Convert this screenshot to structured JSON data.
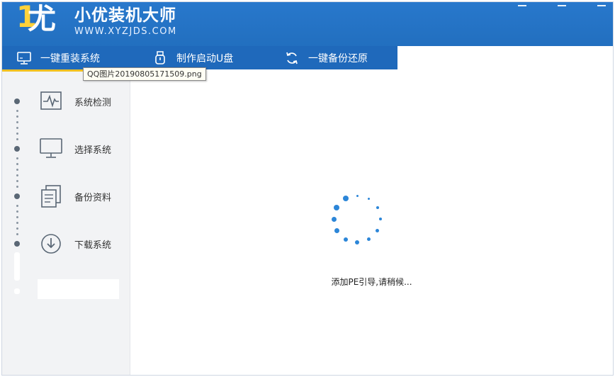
{
  "brand": {
    "logo_digit": "1",
    "logo_char": "尤",
    "name": "小优装机大师",
    "url": "WWW.XYZJDS.COM"
  },
  "tabs": [
    {
      "label": "一键重装系统",
      "icon": "monitor-icon",
      "active": true
    },
    {
      "label": "制作启动U盘",
      "icon": "usb-icon",
      "active": false
    },
    {
      "label": "一键备份还原",
      "icon": "refresh-icon",
      "active": false
    }
  ],
  "tooltip": "QQ图片20190805171509.png",
  "steps": [
    {
      "label": "系统检测",
      "icon": "pulse-monitor-icon"
    },
    {
      "label": "选择系统",
      "icon": "desktop-icon"
    },
    {
      "label": "备份资料",
      "icon": "documents-icon"
    },
    {
      "label": "下载系统",
      "icon": "download-icon"
    }
  ],
  "main": {
    "status": "添加PE引导,请稍候..."
  },
  "colors": {
    "header": "#2878cc",
    "tabbar": "#1f69bb",
    "active_underline": "#f0c021",
    "accent": "#2c86d8"
  }
}
